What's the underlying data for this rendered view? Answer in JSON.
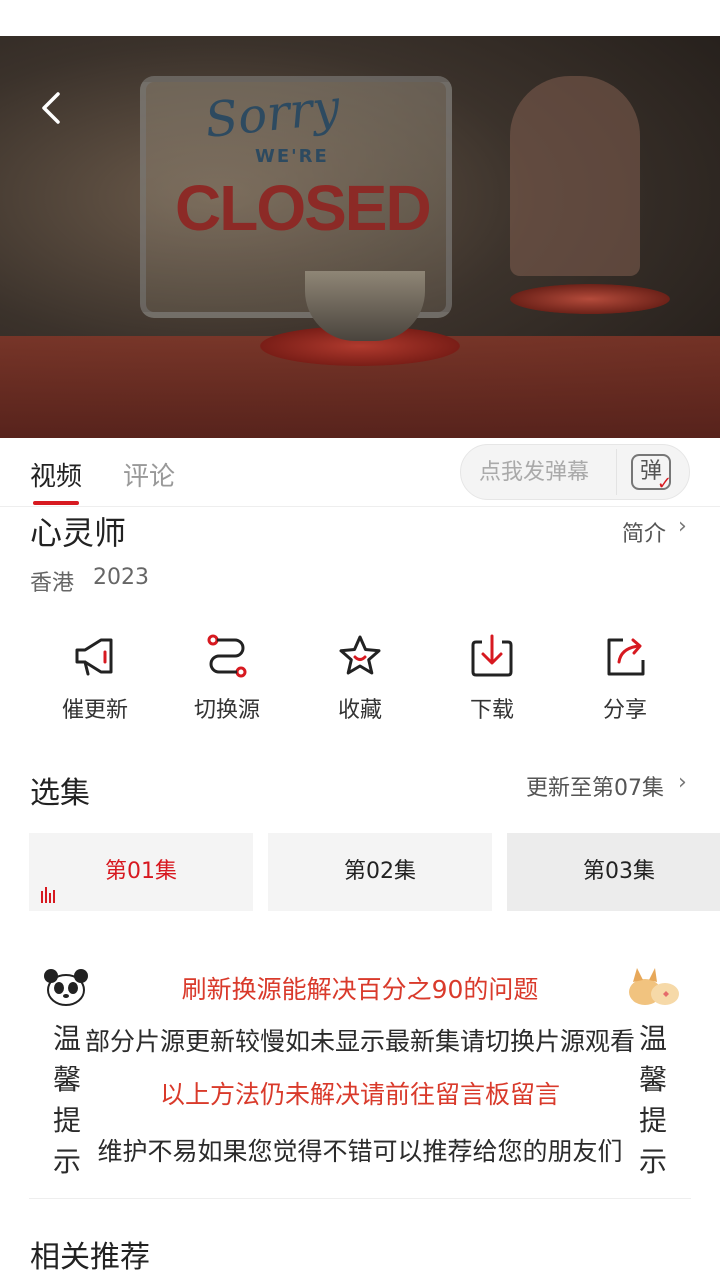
{
  "player": {
    "sign_text_1": "Sorry",
    "sign_text_2": "WE'RE",
    "sign_text_3": "CLOSED"
  },
  "tabs": [
    {
      "label": "视频",
      "active": true
    },
    {
      "label": "评论",
      "active": false
    }
  ],
  "danmu": {
    "placeholder": "点我发弹幕",
    "button_label": "弹"
  },
  "show": {
    "title": "心灵师",
    "intro_label": "简介",
    "region": "香港",
    "year": "2023"
  },
  "actions": [
    {
      "label": "催更新",
      "icon": "megaphone-icon"
    },
    {
      "label": "切换源",
      "icon": "route-switch-icon"
    },
    {
      "label": "收藏",
      "icon": "star-icon"
    },
    {
      "label": "下载",
      "icon": "download-icon"
    },
    {
      "label": "分享",
      "icon": "share-icon"
    }
  ],
  "episodes_section": {
    "title": "选集",
    "update_status": "更新至第07集",
    "episodes": [
      {
        "label": "第01集",
        "playing": true
      },
      {
        "label": "第02集",
        "playing": false
      },
      {
        "label": "第03集",
        "playing": false
      }
    ]
  },
  "notice": {
    "line1": "刷新换源能解决百分之90的问题",
    "line2": "部分片源更新较慢如未显示最新集请切换片源观看",
    "line3": "以上方法仍未解决请前往留言板留言",
    "line4": "维护不易如果您觉得不错可以推荐给您的朋友们",
    "side_left": "温馨提示",
    "side_right": "温馨提示"
  },
  "related": {
    "title": "相关推荐"
  },
  "colors": {
    "accent": "#d71920",
    "notice_red": "#d93a2b"
  }
}
